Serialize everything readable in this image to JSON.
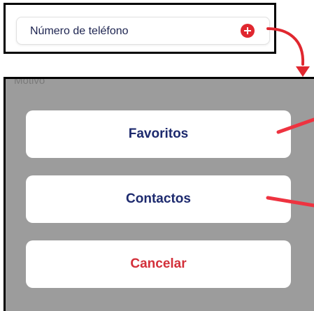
{
  "phone_field": {
    "label": "Número de teléfono",
    "add_icon": "plus-circle-icon"
  },
  "action_sheet": {
    "ghost_label": "Motivo",
    "favorites_label": "Favoritos",
    "contacts_label": "Contactos",
    "cancel_label": "Cancelar"
  },
  "colors": {
    "accent_red": "#e0272f",
    "label_navy": "#1d2a6e",
    "cancel_red": "#d3303a",
    "backdrop_gray": "#9c9c9c"
  }
}
